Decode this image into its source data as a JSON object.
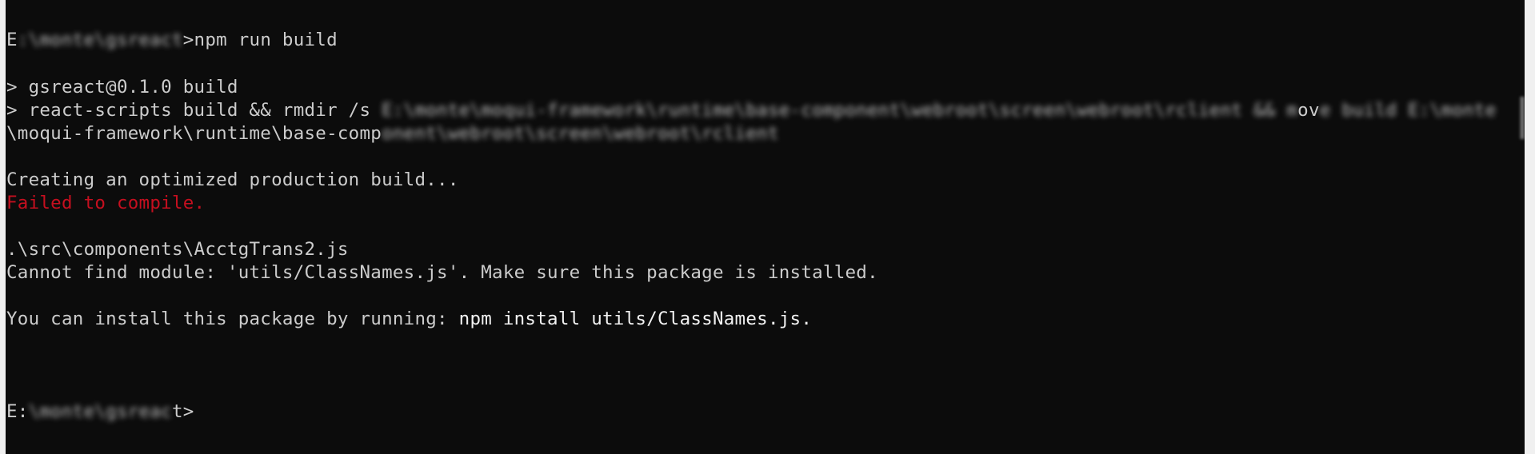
{
  "terminal": {
    "prompt1": {
      "drive": "E",
      "path_redacted": ":\\monte\\gsreact",
      "command": ">npm run build"
    },
    "script_header": "> gsreact@0.1.0 build",
    "script_cmd": {
      "visible": "> react-scripts build && rmdir /s ",
      "redacted_a": "E:\\monte\\moqui-framework\\runtime\\base-component\\webroot\\screen\\webroot\\rclient && m",
      "sharp": "ov",
      "redacted_b": "e build E:\\monte",
      "wrap_visible": "\\moqui-framework\\runtime\\base-comp",
      "wrap_redacted": "onent\\webroot\\screen\\webroot\\rclient"
    },
    "creating": "Creating an optimized production build...",
    "failed": "Failed to compile.",
    "file": ".\\src\\components\\AcctgTrans2.js",
    "error": "Cannot find module: 'utils/ClassNames.js'. Make sure this package is installed.",
    "install_hint": {
      "prefix": "You can install this package by running: ",
      "command": "npm install utils/ClassNames.js."
    },
    "prompt2": {
      "drive": "E:",
      "path_redacted": "\\monte\\gsreac",
      "suffix": "t>"
    }
  },
  "colors": {
    "background": "#0c0c0c",
    "foreground": "#cccccc",
    "error": "#c50f1f",
    "bright": "#f2f2f2"
  }
}
